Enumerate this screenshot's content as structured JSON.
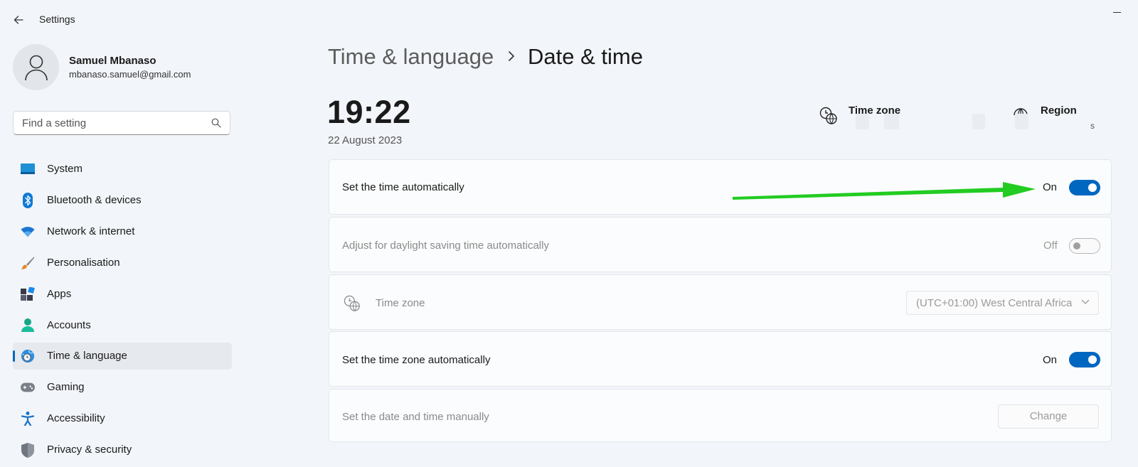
{
  "window": {
    "title": "Settings"
  },
  "profile": {
    "name": "Samuel Mbanaso",
    "email": "mbanaso.samuel@gmail.com"
  },
  "search": {
    "placeholder": "Find a setting",
    "value": ""
  },
  "sidebar": {
    "items": [
      {
        "label": "System",
        "icon": "system-icon"
      },
      {
        "label": "Bluetooth & devices",
        "icon": "bluetooth-icon"
      },
      {
        "label": "Network & internet",
        "icon": "wifi-icon"
      },
      {
        "label": "Personalisation",
        "icon": "brush-icon"
      },
      {
        "label": "Apps",
        "icon": "apps-icon"
      },
      {
        "label": "Accounts",
        "icon": "person-icon"
      },
      {
        "label": "Time & language",
        "icon": "globe-clock-icon",
        "selected": true
      },
      {
        "label": "Gaming",
        "icon": "gamepad-icon"
      },
      {
        "label": "Accessibility",
        "icon": "accessibility-icon"
      },
      {
        "label": "Privacy & security",
        "icon": "shield-icon"
      }
    ]
  },
  "header": {
    "parent": "Time & language",
    "current": "Date & time"
  },
  "clock": {
    "time": "19:22",
    "date": "22 August 2023"
  },
  "info": {
    "timezone_title": "Time zone",
    "region_title": "Region",
    "region_value_visible": "s"
  },
  "settings": {
    "auto_time": {
      "label": "Set the time automatically",
      "state": "On",
      "on": true
    },
    "dst": {
      "label": "Adjust for daylight saving time automatically",
      "state": "Off",
      "on": false,
      "disabled": true
    },
    "timezone": {
      "label": "Time zone",
      "value": "(UTC+01:00) West Central Africa",
      "disabled": true
    },
    "auto_timezone": {
      "label": "Set the time zone automatically",
      "state": "On",
      "on": true
    },
    "manual": {
      "label": "Set the date and time manually",
      "button": "Change",
      "disabled": true
    }
  },
  "colors": {
    "accent": "#0067c0",
    "annotation_arrow": "#22cc22",
    "background": "#f2f5f9"
  }
}
